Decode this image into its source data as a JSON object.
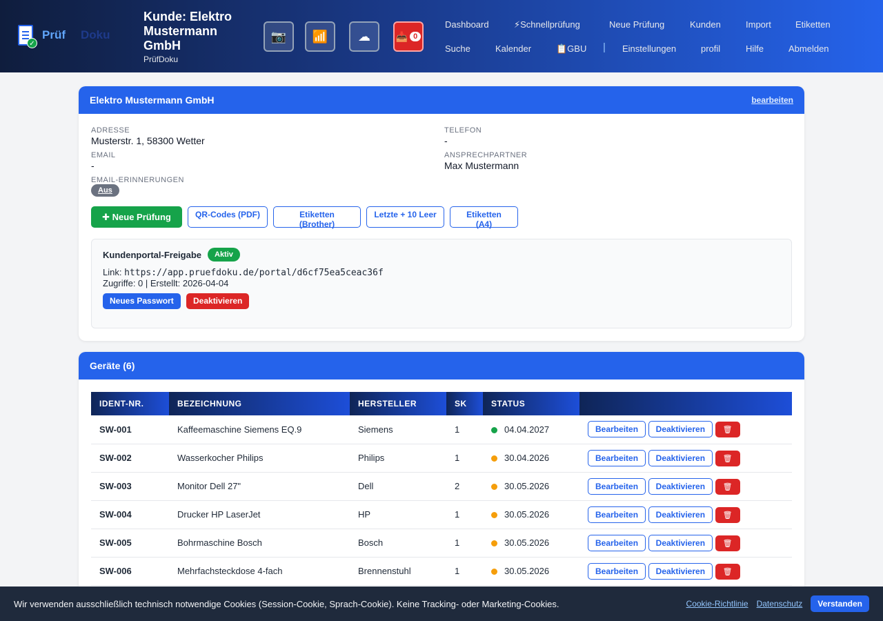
{
  "header": {
    "logo_part1": "Prüf",
    "logo_part2": "Doku",
    "title": "Kunde: Elektro Mustermann GmbH",
    "subtitle": "PrüfDoku",
    "icons": {
      "camera": "📷",
      "signal": "📶",
      "cloud": "☁",
      "inbox": "📥"
    },
    "inbox_count": "0",
    "nav_row1": [
      "Dashboard",
      "⚡Schnellprüfung",
      "Neue Prüfung",
      "Kunden",
      "Import",
      "Etiketten"
    ],
    "nav_row2": [
      "Suche",
      "Kalender",
      "📋GBU",
      "Einstellungen",
      "profil",
      "Hilfe",
      "Abmelden"
    ],
    "nav_separator": "|"
  },
  "customer": {
    "name": "Elektro Mustermann GmbH",
    "edit_label": "bearbeiten",
    "address_label": "ADRESSE",
    "address": "Musterstr. 1, 58300 Wetter",
    "phone_label": "TELEFON",
    "phone": "-",
    "email_label": "EMAIL",
    "email": "-",
    "contact_label": "ANSPRECHPARTNER",
    "contact": "Max Mustermann",
    "reminders_label": "EMAIL-ERINNERUNGEN",
    "reminders_value": "Aus",
    "actions": {
      "new_test": "✚ Neue Prüfung",
      "qr_codes": "QR-Codes (PDF)",
      "labels_brother": "Etiketten (Brother)",
      "last_plus_10": "Letzte + 10 Leer",
      "labels_a4": "Etiketten (A4)"
    }
  },
  "portal": {
    "title": "Kundenportal-Freigabe",
    "status": "Aktiv",
    "link_label": "Link:",
    "link": "https://app.pruefdoku.de/portal/d6cf75ea5ceac36f",
    "meta": "Zugriffe: 0 | Erstellt: 2026-04-04",
    "new_password": "Neues Passwort",
    "deactivate": "Deaktivieren"
  },
  "devices": {
    "title": "Geräte (6)",
    "columns": [
      "IDENT-NR.",
      "BEZEICHNUNG",
      "HERSTELLER",
      "SK",
      "STATUS",
      ""
    ],
    "edit_label": "Bearbeiten",
    "deactivate_label": "Deaktivieren",
    "delete_icon": "🗑",
    "status_colors": {
      "ok": "#16a34a",
      "due": "#f59e0b"
    },
    "rows": [
      {
        "ident": "SW-001",
        "name": "Kaffeemaschine Siemens EQ.9",
        "maker": "Siemens",
        "sk": "1",
        "status": "ok",
        "date": "04.04.2027"
      },
      {
        "ident": "SW-002",
        "name": "Wasserkocher Philips",
        "maker": "Philips",
        "sk": "1",
        "status": "due",
        "date": "30.04.2026"
      },
      {
        "ident": "SW-003",
        "name": "Monitor Dell 27\"",
        "maker": "Dell",
        "sk": "2",
        "status": "due",
        "date": "30.05.2026"
      },
      {
        "ident": "SW-004",
        "name": "Drucker HP LaserJet",
        "maker": "HP",
        "sk": "1",
        "status": "due",
        "date": "30.05.2026"
      },
      {
        "ident": "SW-005",
        "name": "Bohrmaschine Bosch",
        "maker": "Bosch",
        "sk": "1",
        "status": "due",
        "date": "30.05.2026"
      },
      {
        "ident": "SW-006",
        "name": "Mehrfachsteckdose 4-fach",
        "maker": "Brennenstuhl",
        "sk": "1",
        "status": "due",
        "date": "30.05.2026"
      }
    ]
  },
  "cookie": {
    "text": "Wir verwenden ausschließlich technisch notwendige Cookies (Session-Cookie, Sprach-Cookie). Keine Tracking- oder Marketing-Cookies.",
    "policy_link": "Cookie-Richtlinie",
    "privacy_link": "Datenschutz",
    "accept": "Verstanden"
  }
}
